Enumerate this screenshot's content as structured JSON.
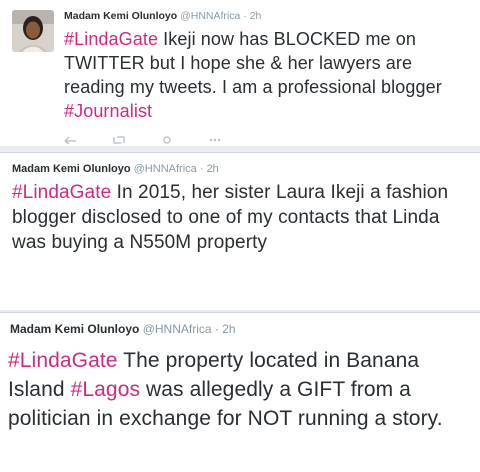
{
  "tweets": [
    {
      "name": "Madam Kemi Olunloyo",
      "handle": "@HNNAfrica",
      "time": "2h",
      "segments": [
        {
          "text": "#LindaGate",
          "tag": true
        },
        {
          "text": " Ikeji now has BLOCKED me on TWITTER but I hope she & her lawyers are reading my tweets. I am a professional blogger ",
          "tag": false
        },
        {
          "text": "#Journalist",
          "tag": true
        }
      ]
    },
    {
      "name": "Madam Kemi Olunloyo",
      "handle": "@HNNAfrica",
      "time": "2h",
      "segments": [
        {
          "text": "#LindaGate",
          "tag": true
        },
        {
          "text": " In 2015, her sister Laura Ikeji a fashion blogger disclosed to one of my contacts that Linda was buying a N550M property",
          "tag": false
        }
      ]
    },
    {
      "name": "Madam Kemi Olunloyo",
      "handle": "@HNNAfrica",
      "time": "2h",
      "segments": [
        {
          "text": "#LindaGate",
          "tag": true
        },
        {
          "text": " The property located in Banana Island ",
          "tag": false
        },
        {
          "text": "#Lagos",
          "tag": true
        },
        {
          "text": " was allegedly a GIFT from a politician in exchange for NOT running a story.",
          "tag": false
        }
      ]
    }
  ],
  "colors": {
    "hashtag": "#cc2b84",
    "name": "#292f33",
    "meta": "#8899a6",
    "separator": "#e9ecee"
  },
  "icons": [
    "avatar",
    "reply-icon",
    "retweet-icon",
    "like-icon",
    "more-icon"
  ]
}
